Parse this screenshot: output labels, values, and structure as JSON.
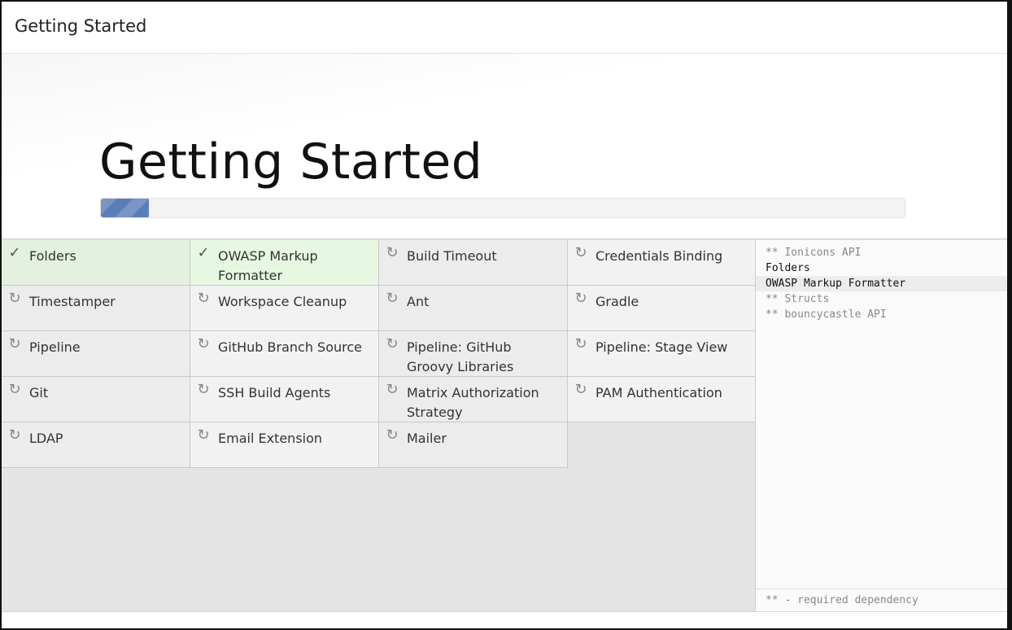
{
  "header": {
    "title": "Getting Started"
  },
  "hero": {
    "title": "Getting Started",
    "progress_percent": 6
  },
  "plugins": [
    {
      "label": "Folders",
      "status": "installed",
      "icon": "check-icon"
    },
    {
      "label": "OWASP Markup Formatter",
      "status": "installed",
      "icon": "check-icon"
    },
    {
      "label": "Build Timeout",
      "status": "pending",
      "icon": "refresh-icon"
    },
    {
      "label": "Credentials Binding",
      "status": "pending",
      "icon": "refresh-icon"
    },
    {
      "label": "Timestamper",
      "status": "pending",
      "icon": "refresh-icon"
    },
    {
      "label": "Workspace Cleanup",
      "status": "pending",
      "icon": "refresh-icon"
    },
    {
      "label": "Ant",
      "status": "pending",
      "icon": "refresh-icon"
    },
    {
      "label": "Gradle",
      "status": "pending",
      "icon": "refresh-icon"
    },
    {
      "label": "Pipeline",
      "status": "pending",
      "icon": "refresh-icon"
    },
    {
      "label": "GitHub Branch Source",
      "status": "pending",
      "icon": "refresh-icon"
    },
    {
      "label": "Pipeline: GitHub Groovy Libraries",
      "status": "pending",
      "icon": "refresh-icon"
    },
    {
      "label": "Pipeline: Stage View",
      "status": "pending",
      "icon": "refresh-icon"
    },
    {
      "label": "Git",
      "status": "pending",
      "icon": "refresh-icon"
    },
    {
      "label": "SSH Build Agents",
      "status": "pending",
      "icon": "refresh-icon"
    },
    {
      "label": "Matrix Authorization Strategy",
      "status": "pending",
      "icon": "refresh-icon"
    },
    {
      "label": "PAM Authentication",
      "status": "pending",
      "icon": "refresh-icon"
    },
    {
      "label": "LDAP",
      "status": "pending",
      "icon": "refresh-icon"
    },
    {
      "label": "Email Extension",
      "status": "pending",
      "icon": "refresh-icon"
    },
    {
      "label": "Mailer",
      "status": "pending",
      "icon": "refresh-icon"
    }
  ],
  "log": {
    "lines": [
      {
        "text": "** Ionicons API",
        "kind": "dependency"
      },
      {
        "text": "Folders",
        "kind": "plugin"
      },
      {
        "text": "OWASP Markup Formatter",
        "kind": "current"
      },
      {
        "text": "** Structs",
        "kind": "dependency"
      },
      {
        "text": "** bouncycastle API",
        "kind": "dependency"
      }
    ],
    "footnote": "** - required dependency"
  },
  "colors": {
    "progress": "#5c7eb8",
    "installed": "#e4f1e0"
  }
}
